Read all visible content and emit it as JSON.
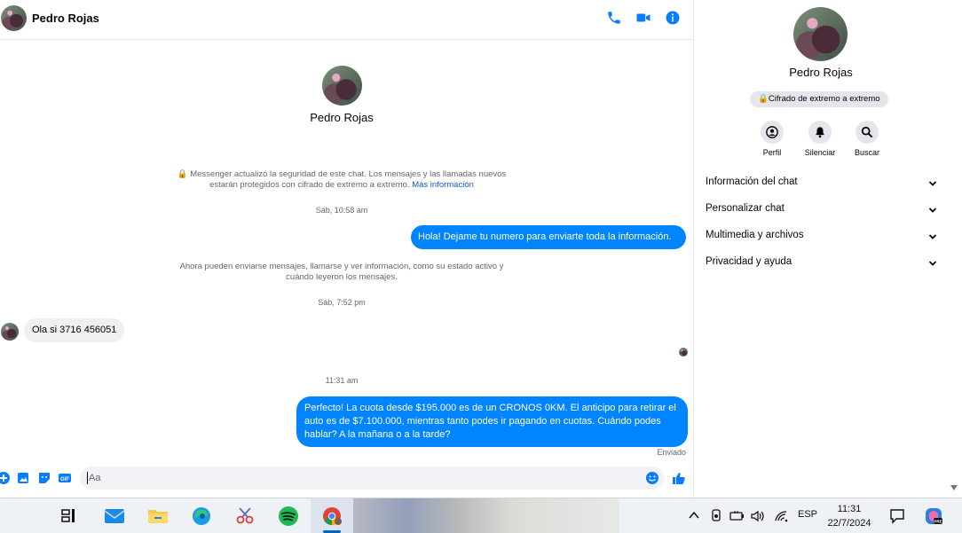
{
  "contact": {
    "name": "Pedro Rojas"
  },
  "chat": {
    "security_note": "Messenger actualizó la seguridad de este chat. Los mensajes y las llamadas nuevos estarán protegidos con cifrado de extremo a extremo.",
    "security_link": "Más información",
    "time1": "Sáb, 10:58 am",
    "msg_out_1": "Hola! Dejame tu numero  para enviarte toda la información.",
    "status_note": "Ahora pueden enviarse mensajes, llamarse y ver información, como su estado activo y cuándo leyeron los mensajes.",
    "time2": "Sáb, 7:52 pm",
    "msg_in_1": "Ola si 3716 456051",
    "time3": "11:31 am",
    "msg_out_2": "Perfecto! La cuota desde $195.000 es de un CRONOS 0KM. El anticipo para retirar el auto es de $7.100.000, mientras tanto podes ir pagando en cuotas. Cuándo podes hablar? A la mañana o a la tarde?",
    "sent_status": "Enviado"
  },
  "composer": {
    "placeholder": "Aa"
  },
  "side": {
    "encryption_label": "Cifrado de extremo a extremo",
    "actions": {
      "profile": "Perfil",
      "mute": "Silenciar",
      "search": "Buscar"
    },
    "sections": [
      "Información del chat",
      "Personalizar chat",
      "Multimedia y archivos",
      "Privacidad y ayuda"
    ]
  },
  "taskbar": {
    "language": "ESP",
    "time": "11:31",
    "date": "22/7/2024"
  },
  "colors": {
    "accent": "#0084ff",
    "link": "#0a5ed7",
    "muted": "#65676b"
  }
}
